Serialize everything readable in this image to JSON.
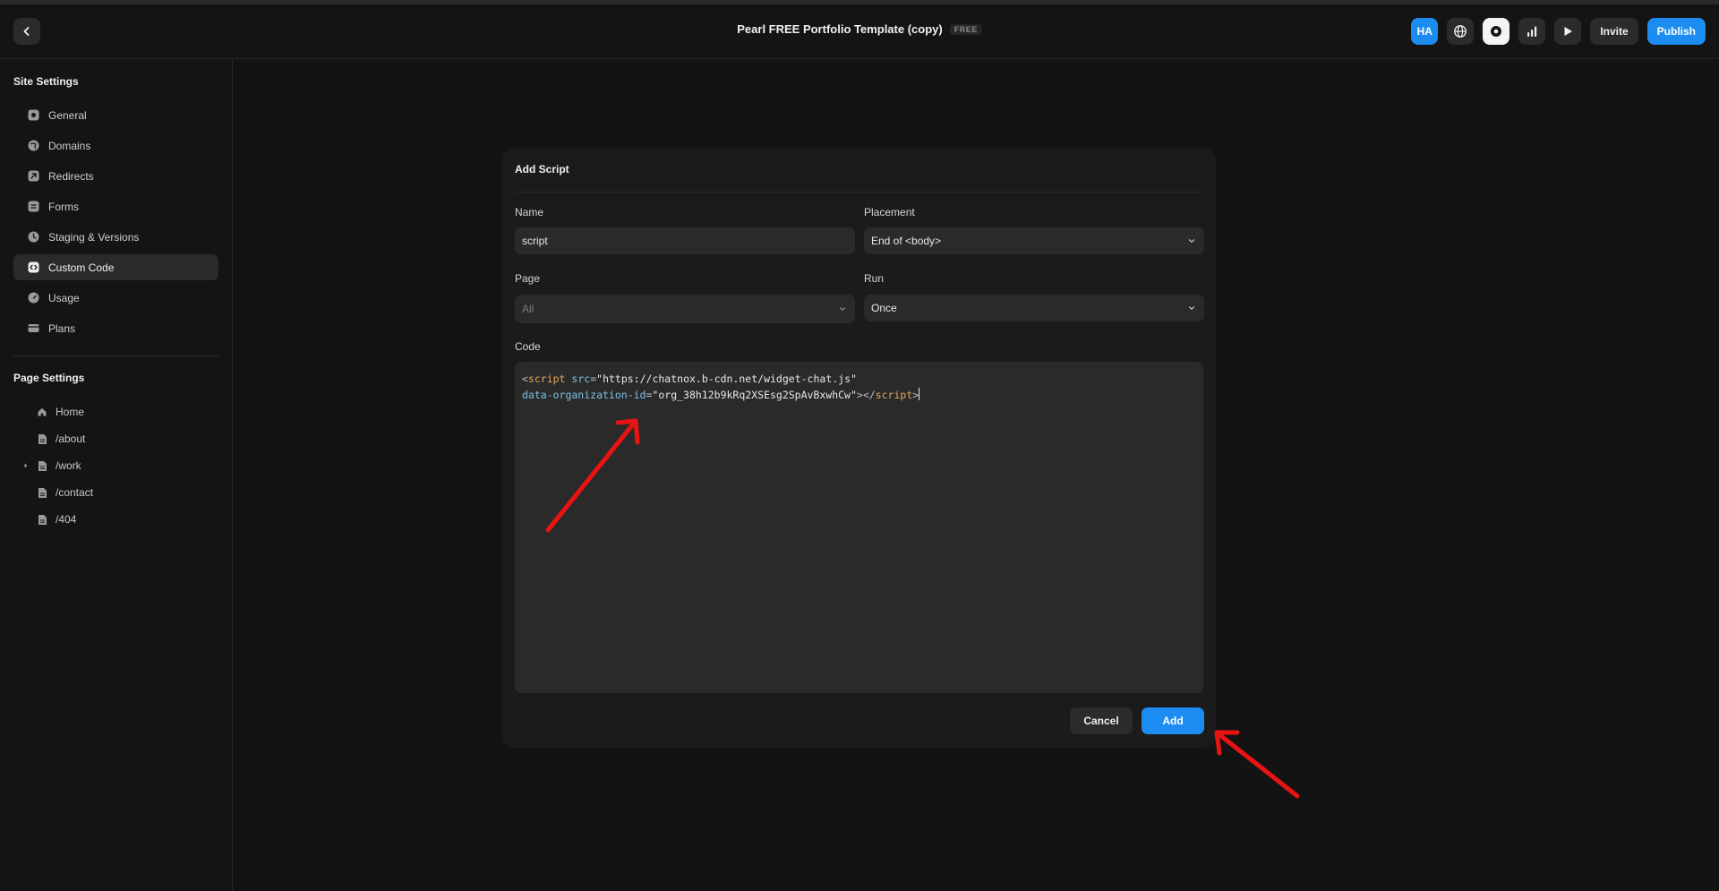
{
  "header": {
    "title": "Pearl FREE Portfolio Template (copy)",
    "badge": "FREE",
    "avatar_initials": "HA",
    "invite_label": "Invite",
    "publish_label": "Publish",
    "back_icon": "chevron-left-icon"
  },
  "sidebar": {
    "site_heading": "Site Settings",
    "site_items": [
      {
        "label": "General",
        "icon": "gear-icon"
      },
      {
        "label": "Domains",
        "icon": "globe-icon"
      },
      {
        "label": "Redirects",
        "icon": "redirect-icon"
      },
      {
        "label": "Forms",
        "icon": "form-icon"
      },
      {
        "label": "Staging & Versions",
        "icon": "clock-icon"
      },
      {
        "label": "Custom Code",
        "icon": "code-icon",
        "active": true
      },
      {
        "label": "Usage",
        "icon": "gauge-icon"
      },
      {
        "label": "Plans",
        "icon": "card-icon"
      }
    ],
    "page_heading": "Page Settings",
    "page_items": [
      {
        "label": "Home",
        "icon": "home-icon"
      },
      {
        "label": "/about",
        "icon": "file-icon"
      },
      {
        "label": "/work",
        "icon": "file-icon",
        "expandable": true
      },
      {
        "label": "/contact",
        "icon": "file-icon"
      },
      {
        "label": "/404",
        "icon": "file-icon"
      }
    ]
  },
  "modal": {
    "title": "Add Script",
    "name_label": "Name",
    "name_value": "script",
    "placement_label": "Placement",
    "placement_value": "End of <body>",
    "page_label": "Page",
    "page_value": "All",
    "run_label": "Run",
    "run_value": "Once",
    "code_label": "Code",
    "code": {
      "open_bracket": "<",
      "tag": "script",
      "src_attr": "src",
      "equals": "=",
      "src_value": "\"https://chatnox.b-cdn.net/widget-chat.js\"",
      "org_attr": "data-organization-id",
      "org_value": "\"org_38h12b9kRq2XSEsg2SpAvBxwhCw\"",
      "close_open_tag": ">",
      "closing_tag_open": "</",
      "closing_tag_name": "script",
      "closing_tag_close": ">"
    },
    "cancel_label": "Cancel",
    "add_label": "Add"
  },
  "colors": {
    "accent": "#1d8cf0",
    "background": "#131313",
    "panel": "#1b1b1b",
    "annotation": "#e81414"
  }
}
